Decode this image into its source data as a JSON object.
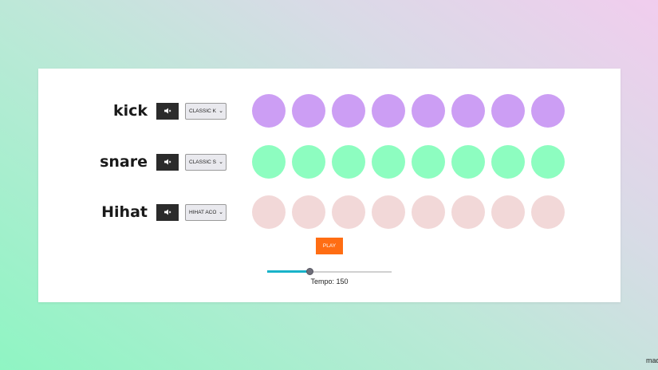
{
  "tracks": [
    {
      "name": "kick",
      "sound": "CLASSIC KICK",
      "pad_color": "#cc9ef4",
      "pads": 8
    },
    {
      "name": "snare",
      "sound": "CLASSIC SNARE",
      "pad_color": "#8dfdc0",
      "pads": 8
    },
    {
      "name": "Hihat",
      "sound": "HIHAT ACOUSTI",
      "pad_color": "#f2d8d8",
      "pads": 8
    }
  ],
  "mute_icon": "speaker-mute-icon",
  "play_label": "PLAY",
  "play_color": "#ff6d13",
  "tempo": {
    "label": "Tempo:",
    "value": 150,
    "min": 20,
    "max": 400
  },
  "corner_text": "mad"
}
